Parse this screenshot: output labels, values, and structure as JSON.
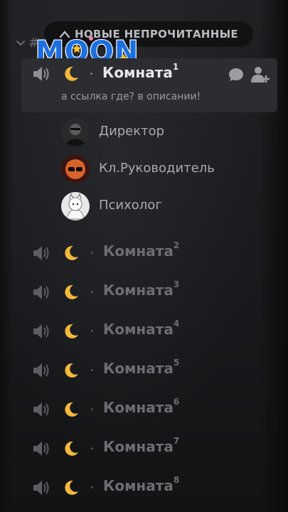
{
  "banner": {
    "new_unread": "НОВЫЕ НЕПРОЧИТАННЫЕ",
    "hash": "#"
  },
  "logo": {
    "text": "MOON"
  },
  "active_room": {
    "name": "Комната",
    "number": "1",
    "topic": "а ссылка где? в описании!"
  },
  "members": [
    {
      "name": "Директор"
    },
    {
      "name": "Кл.Руководитель"
    },
    {
      "name": "Психолог"
    }
  ],
  "rooms": [
    {
      "name": "Комната",
      "number": "2"
    },
    {
      "name": "Комната",
      "number": "3"
    },
    {
      "name": "Комната",
      "number": "4"
    },
    {
      "name": "Комната",
      "number": "5"
    },
    {
      "name": "Комната",
      "number": "6"
    },
    {
      "name": "Комната",
      "number": "7"
    },
    {
      "name": "Комната",
      "number": "8"
    }
  ],
  "separator": "·",
  "icons": {
    "voice": "speaker-icon",
    "moon": "crescent-moon-emoji",
    "chat": "chat-bubble-icon",
    "invite": "add-user-icon"
  },
  "colors": {
    "background": "#1c1d20",
    "active_row": "#2b2d31",
    "moon": "#f4b93a",
    "logo_blue": "#1b6fe0"
  }
}
